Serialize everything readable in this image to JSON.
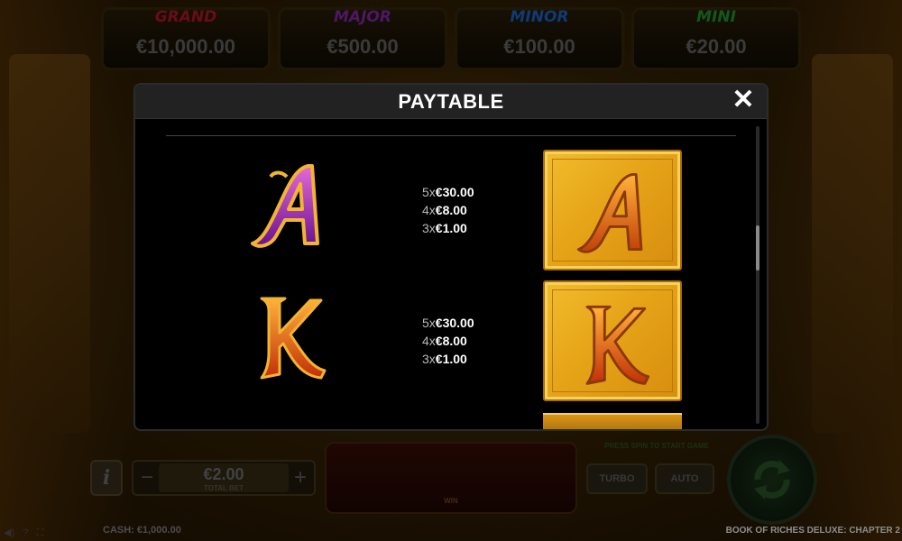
{
  "jackpots": [
    {
      "name": "GRAND",
      "value": "€10,000.00",
      "color": "#c0162a"
    },
    {
      "name": "MAJOR",
      "value": "€500.00",
      "color": "#8a2ab8"
    },
    {
      "name": "MINOR",
      "value": "€100.00",
      "color": "#1a6ad8"
    },
    {
      "name": "MINI",
      "value": "€20.00",
      "color": "#22a030"
    }
  ],
  "modal": {
    "title": "PAYTABLE",
    "close_icon": "close-icon",
    "rows": [
      {
        "symbol": "A",
        "pays": [
          {
            "mult": "5x",
            "amount": "€30.00"
          },
          {
            "mult": "4x",
            "amount": "€8.00"
          },
          {
            "mult": "3x",
            "amount": "€1.00"
          }
        ]
      },
      {
        "symbol": "K",
        "pays": [
          {
            "mult": "5x",
            "amount": "€30.00"
          },
          {
            "mult": "4x",
            "amount": "€8.00"
          },
          {
            "mult": "3x",
            "amount": "€1.00"
          }
        ]
      }
    ]
  },
  "controls": {
    "info": "i",
    "minus": "−",
    "plus": "+",
    "bet_value": "€2.00",
    "bet_label": "TOTAL BET",
    "win_label": "WIN",
    "press_text": "PRESS SPIN TO START GAME",
    "turbo": "TURBO",
    "auto": "AUTO",
    "spin_icon": "spin-arrows-icon"
  },
  "footer": {
    "cash": "CASH:  €1,000.00",
    "game_title": "BOOK OF RICHES DELUXE: CHAPTER 2"
  }
}
